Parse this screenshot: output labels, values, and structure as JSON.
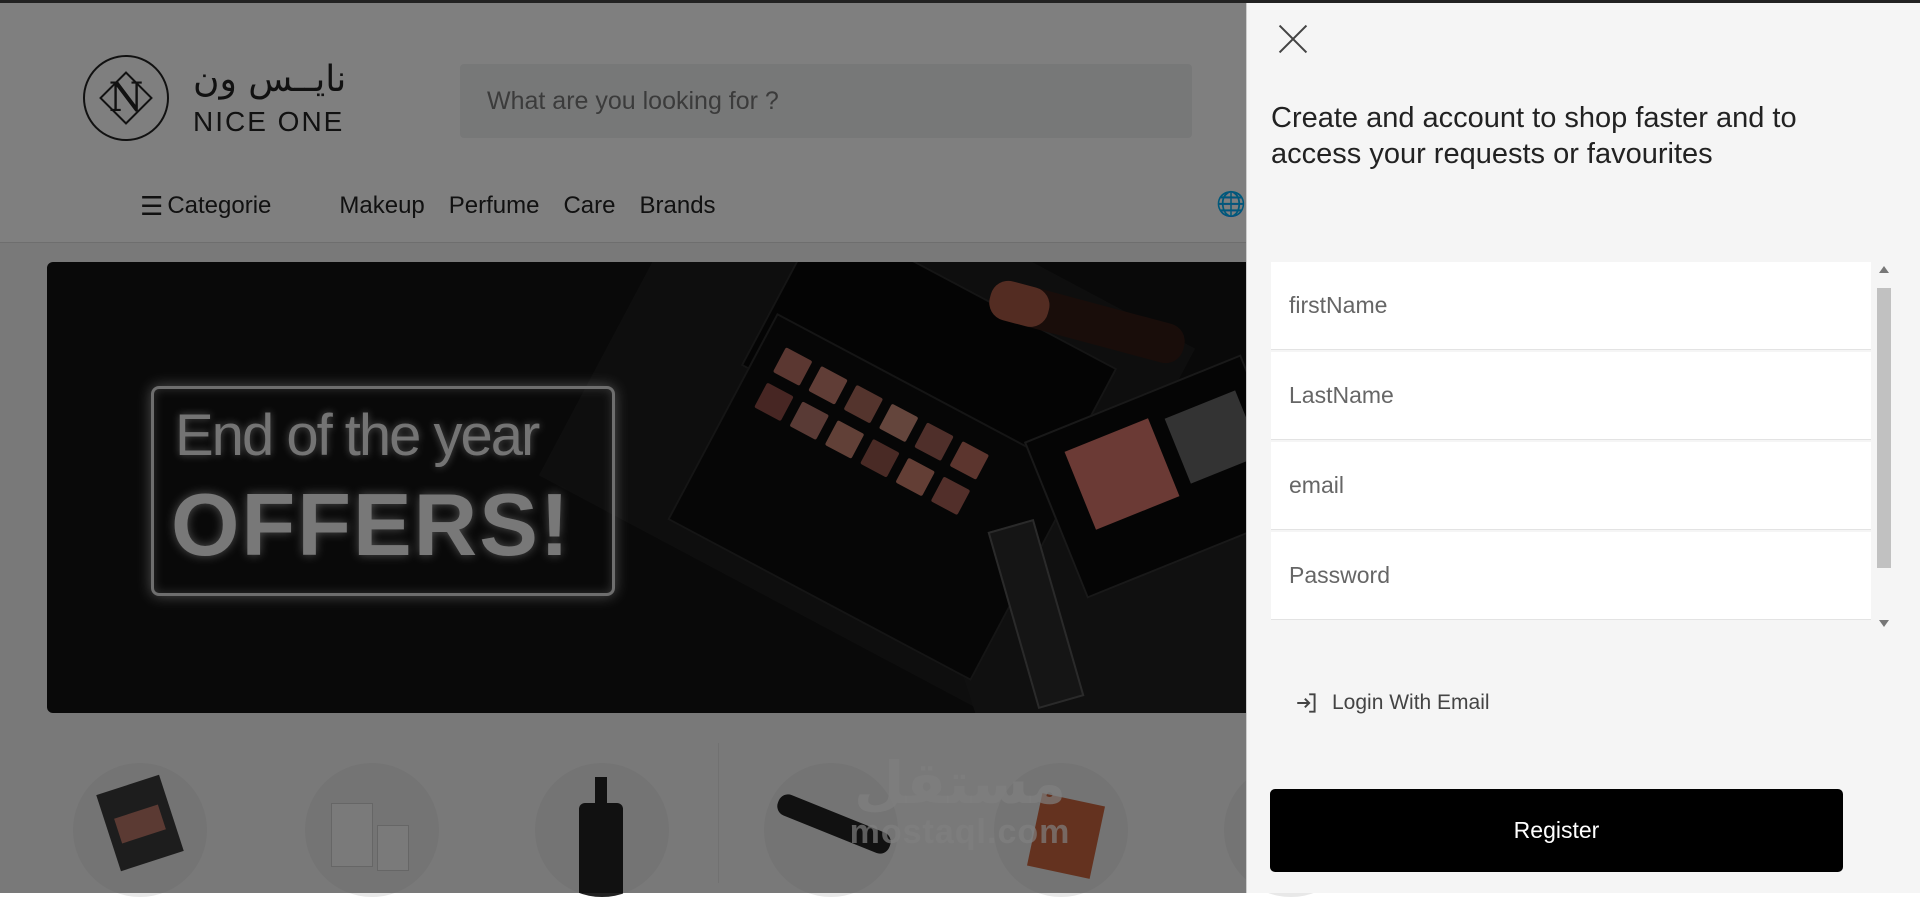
{
  "header": {
    "logo_arabic": "نايــس ون",
    "logo_latin": "NICE ONE",
    "search_placeholder": "What are you looking for ?",
    "nav": {
      "categories_label": "Categorie",
      "links": [
        "Makeup",
        "Perfume",
        "Care",
        "Brands"
      ]
    }
  },
  "hero": {
    "line1": "End of the year",
    "line2": "OFFERS!"
  },
  "watermark": {
    "arabic": "مستقل",
    "latin": "mostaql.com"
  },
  "drawer": {
    "headline": "Create and account to shop faster and to access your requests or favourites",
    "fields": {
      "first_name_placeholder": "firstName",
      "last_name_placeholder": "LastName",
      "email_placeholder": "email",
      "password_placeholder": "Password"
    },
    "login_with_email_label": "Login With Email",
    "register_label": "Register"
  },
  "colors": {
    "overlay": "#000000",
    "drawer_background": "#f5f5f5",
    "register_button": "#000000",
    "register_text": "#ffffff"
  },
  "icons": [
    "close-icon",
    "hamburger-icon",
    "globe-icon",
    "login-icon"
  ]
}
